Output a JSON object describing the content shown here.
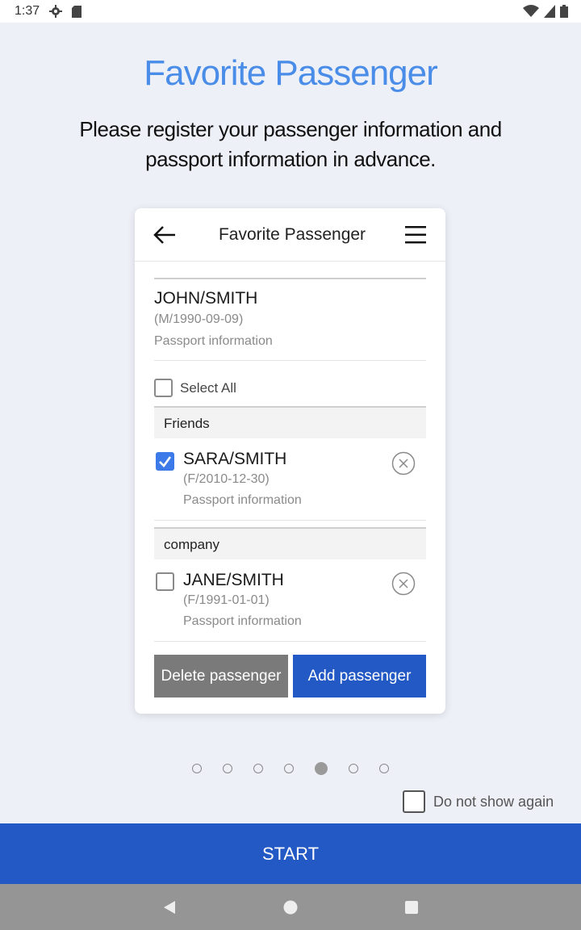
{
  "status_bar": {
    "time": "1:37"
  },
  "headline": "Favorite Passenger",
  "subhead": "Please register your passenger information and passport information in advance.",
  "card": {
    "title": "Favorite Passenger",
    "primary": {
      "name": "JOHN/SMITH",
      "meta": "(M/1990-09-09)",
      "passport": "Passport information"
    },
    "select_all_label": "Select All",
    "groups": [
      {
        "label": "Friends",
        "passenger": {
          "name": "SARA/SMITH",
          "meta": "(F/2010-12-30)",
          "passport": "Passport information",
          "checked": true
        }
      },
      {
        "label": "company",
        "passenger": {
          "name": "JANE/SMITH",
          "meta": "(F/1991-01-01)",
          "passport": "Passport information",
          "checked": false
        }
      }
    ],
    "delete_label": "Delete passenger",
    "add_label": "Add passenger"
  },
  "pager": {
    "count": 7,
    "active_index": 4
  },
  "dont_show_label": "Do not show again",
  "start_label": "START",
  "icons": {
    "status": [
      "settings-icon",
      "sd-card-icon",
      "wifi-icon",
      "signal-icon",
      "battery-icon"
    ],
    "card": [
      "back-arrow-icon",
      "menu-icon",
      "remove-icon",
      "checkmark-icon"
    ],
    "nav": [
      "back-icon",
      "home-icon",
      "recents-icon"
    ]
  },
  "colors": {
    "accent": "#4a8de8",
    "primary_button": "#2359c4",
    "delete_button": "#7a7a7a",
    "checkbox_checked": "#3b7ae8"
  }
}
